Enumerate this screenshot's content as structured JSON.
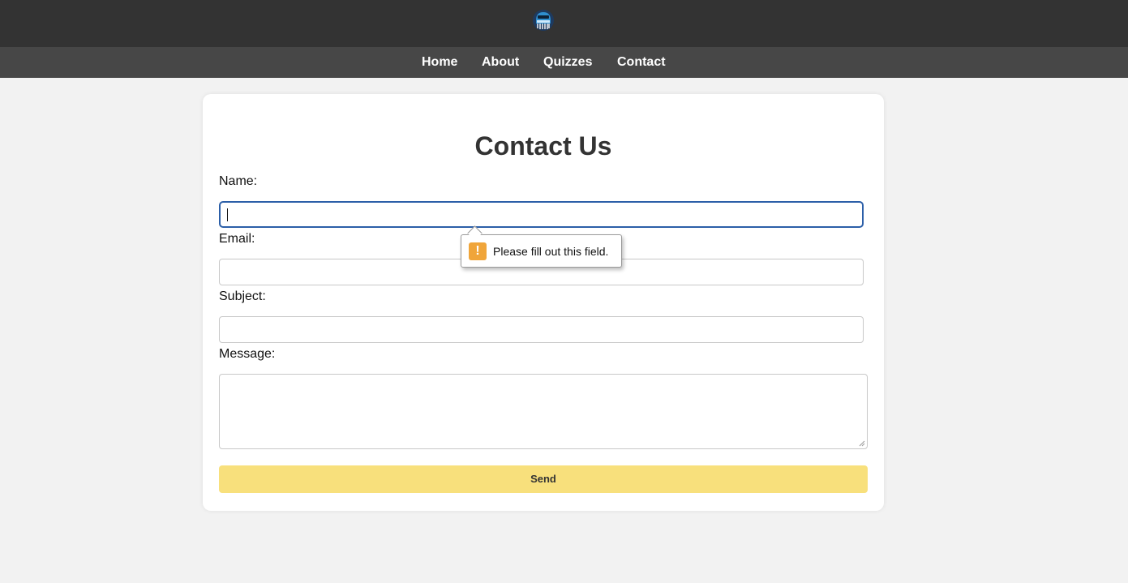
{
  "header": {
    "logo_icon": "helmet-logo-icon"
  },
  "nav": {
    "items": [
      {
        "label": "Home"
      },
      {
        "label": "About"
      },
      {
        "label": "Quizzes"
      },
      {
        "label": "Contact"
      }
    ]
  },
  "form": {
    "title": "Contact Us",
    "name_label": "Name:",
    "name_value": "",
    "email_label": "Email:",
    "email_value": "",
    "subject_label": "Subject:",
    "subject_value": "",
    "message_label": "Message:",
    "message_value": "",
    "send_label": "Send"
  },
  "validation": {
    "message": "Please fill out this field.",
    "icon": "warning-icon",
    "icon_glyph": "!"
  },
  "colors": {
    "topbar": "#333333",
    "navbar": "#474747",
    "send_button": "#f8e07c",
    "focus_border": "#2c5fa8",
    "warning": "#f0a53a"
  }
}
